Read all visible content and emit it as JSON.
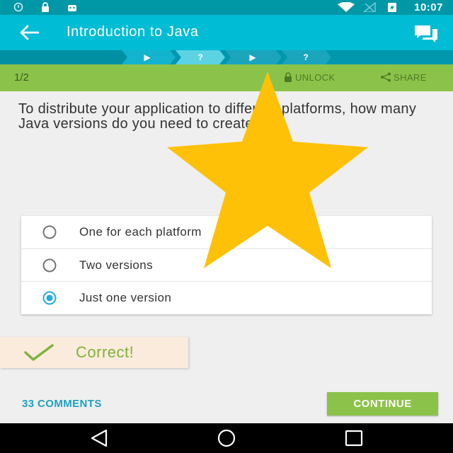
{
  "status_bar": {
    "time": "10:07",
    "icons_left": [
      "sync-icon",
      "lock-icon",
      "android-icon"
    ],
    "icons_right": [
      "wifi-icon",
      "no-signal-icon",
      "battery-icon"
    ]
  },
  "app_bar": {
    "title": "Introduction to Java",
    "back_icon": "arrow-back-icon",
    "chat_icon": "chat-icon"
  },
  "progress_steps": [
    {
      "glyph": "▶"
    },
    {
      "glyph": "?"
    },
    {
      "glyph": "▶"
    },
    {
      "glyph": "?"
    }
  ],
  "lesson_bar": {
    "page": "1/2",
    "unlock_label": "UNLOCK",
    "share_label": "SHARE"
  },
  "question": {
    "text": "To distribute your application to different platforms, how many Java versions do you need to create?"
  },
  "answers": [
    {
      "label": "One for each platform",
      "selected": false
    },
    {
      "label": "Two versions",
      "selected": false
    },
    {
      "label": "Just one version",
      "selected": true
    }
  ],
  "result": {
    "text": "Correct!"
  },
  "footer": {
    "comments_label": "33 COMMENTS",
    "continue_label": "CONTINUE"
  },
  "colors": {
    "status_bar": "#0097a7",
    "app_bar": "#00bcd4",
    "accent_green": "#8bc34a",
    "radio_selected": "#26a9e0",
    "star": "#ffc107"
  }
}
